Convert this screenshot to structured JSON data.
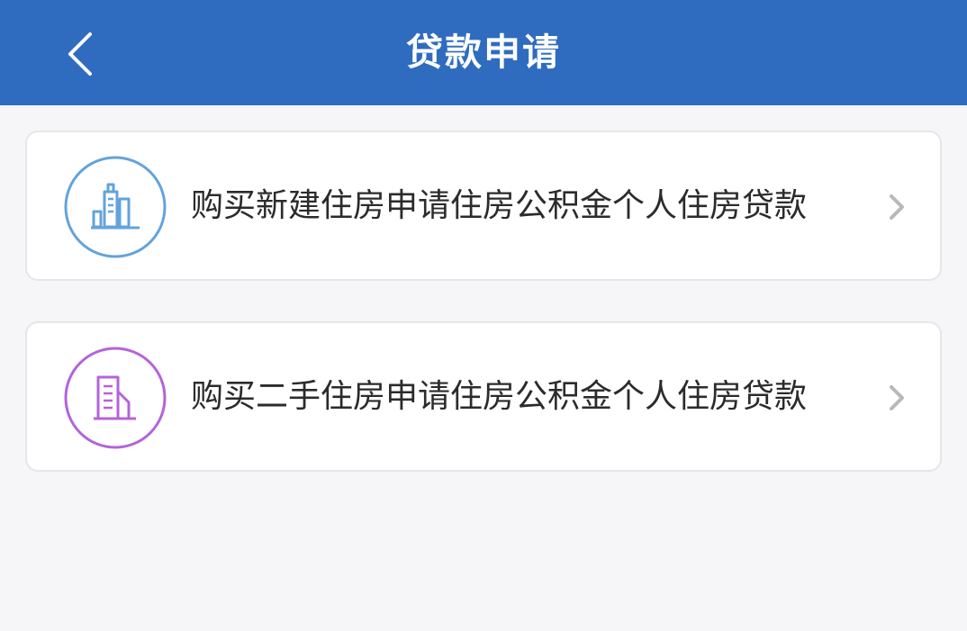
{
  "header": {
    "title": "贷款申请",
    "back_icon": "chevron-left-icon",
    "background_color": "#2f6cc0"
  },
  "options": [
    {
      "label": "购买新建住房申请住房公积金个人住房贷款",
      "icon": "new-building-icon",
      "icon_color": "#62a3dc",
      "chevron_icon": "chevron-right-icon"
    },
    {
      "label": "购买二手住房申请住房公积金个人住房贷款",
      "icon": "second-hand-building-icon",
      "icon_color": "#b563d9",
      "chevron_icon": "chevron-right-icon"
    }
  ]
}
